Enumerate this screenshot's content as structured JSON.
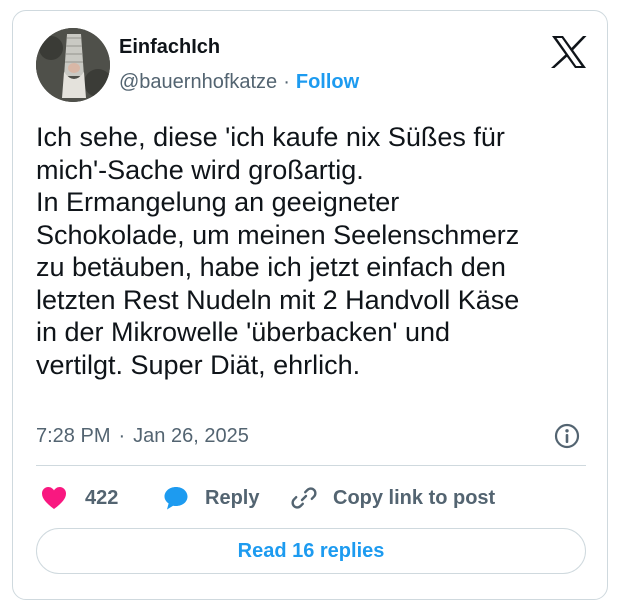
{
  "user": {
    "display_name": "EinfachIch",
    "handle": "@bauernhofkatze",
    "separator": "·",
    "follow_label": "Follow"
  },
  "tweet": {
    "lines": [
      "Ich sehe, diese 'ich kaufe nix Süßes für",
      "mich'-Sache wird großartig.",
      "In Ermangelung an geeigneter",
      "Schokolade, um meinen Seelenschmerz",
      "zu betäuben, habe ich jetzt einfach den",
      "letzten Rest Nudeln mit 2 Handvoll Käse",
      "in der Mikrowelle 'überbacken' und",
      "vertilgt. Super Diät, ehrlich."
    ],
    "time": "7:28 PM",
    "date": "Jan 26, 2025"
  },
  "actions": {
    "like_count": "422",
    "reply_label": "Reply",
    "copy_label": "Copy link to post"
  },
  "replies_button": "Read 16 replies",
  "colors": {
    "accent": "#1d9bf0",
    "like": "#f91880",
    "text": "#0f1419",
    "muted": "#536471",
    "border": "#cfd9de"
  },
  "icons": {
    "brand": "x-logo-icon",
    "info": "info-icon",
    "like": "heart-icon",
    "reply": "speech-bubble-icon",
    "copy": "link-icon"
  }
}
